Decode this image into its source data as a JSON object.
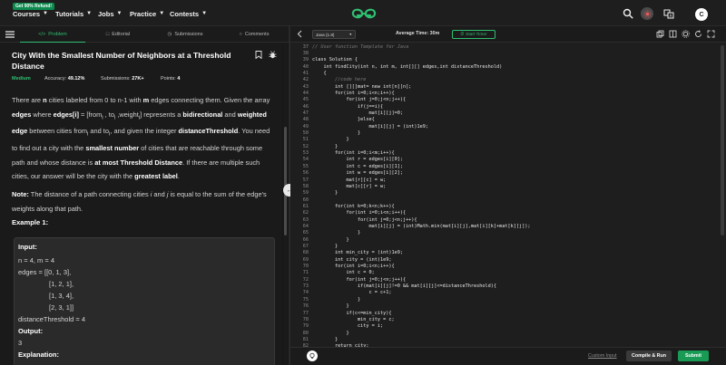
{
  "nav": {
    "promo": "Get 90% Refund!",
    "items": [
      "Courses",
      "Tutorials",
      "Jobs",
      "Practice",
      "Contests"
    ],
    "avatar_letter": "C"
  },
  "left_tabs": [
    {
      "label": "Problem",
      "icon": "code-icon"
    },
    {
      "label": "Editorial",
      "icon": "document-icon"
    },
    {
      "label": "Submissions",
      "icon": "clock-icon"
    },
    {
      "label": "Comments",
      "icon": "comment-icon"
    }
  ],
  "problem": {
    "title": "City With the Smallest Number of Neighbors at a Threshold Distance",
    "difficulty": "Medium",
    "accuracy_label": "Accuracy:",
    "accuracy": "49.12%",
    "submissions_label": "Submissions:",
    "submissions": "27K+",
    "points_label": "Points:",
    "points": "4",
    "desc": {
      "t1": "There are ",
      "n": "n",
      "t2": " cities labeled from 0 to n-1 with ",
      "m": "m",
      "t3": " edges connecting them. Given the array ",
      "edges": "edges",
      "t4": " where ",
      "edges_i": "edges[i]",
      "t5": " = [from",
      "sub_i1": "i",
      "t6": " , to",
      "sub_i2": "i",
      "t7": " ,weight",
      "sub_i3": "i",
      "t8": "]  represents a ",
      "bidirectional": "bidirectional",
      "t9": " and ",
      "weighted": "weighted edge",
      "t10": " between cities from",
      "sub_i4": "i",
      "t11": " and to",
      "sub_i5": "i",
      "t12": ", and given the integer ",
      "threshold": "distanceThreshold",
      "t13": ". You need to find out a city with the ",
      "smallest": "smallest number",
      "t14": " of cities that are reachable through some path and whose distance is ",
      "atmost": "at most Threshold Distance",
      "t15": ". If there are multiple such cities, our answer will be the city with the ",
      "greatest": "greatest label",
      "t16": "."
    },
    "note": {
      "label": "Note:",
      "t1": " The distance of a path connecting cities ",
      "i": "i",
      "t2": " and ",
      "j": "j",
      "t3": " is equal to the sum of the edge's weights along that path."
    },
    "example_title": "Example 1:",
    "example": {
      "input_label": "Input:",
      "l1": "n = 4, m = 4",
      "l2": "edges = [[0, 1, 3],",
      "l3": "[1, 2, 1],",
      "l4": "[1, 3, 4],",
      "l5": "[2, 3, 1]]",
      "l6": "distanceThreshold = 4",
      "output_label": "Output:",
      "output": "3",
      "explanation_label": "Explanation:"
    }
  },
  "editor": {
    "language": "Java (1.8)",
    "avg_time": "Average Time: 30m",
    "start_timer": "Start Timer",
    "lines": [
      {
        "n": "37",
        "code": "// User function Template for Java",
        "cmt": true
      },
      {
        "n": "38",
        "code": ""
      },
      {
        "n": "39",
        "code": "class Solution {"
      },
      {
        "n": "40",
        "code": "    int findCity(int n, int m, int[][] edges,int distanceThreshold)"
      },
      {
        "n": "41",
        "code": "    {"
      },
      {
        "n": "42",
        "code": "        //code here",
        "cmt": true
      },
      {
        "n": "43",
        "code": "        int [][]mat= new int[n][n];"
      },
      {
        "n": "44",
        "code": "        for(int i=0;i<n;i++){"
      },
      {
        "n": "45",
        "code": "            for(int j=0;j<n;j++){"
      },
      {
        "n": "46",
        "code": "                if(j==i){"
      },
      {
        "n": "47",
        "code": "                    mat[i][j]=0;"
      },
      {
        "n": "48",
        "code": "                }else{"
      },
      {
        "n": "49",
        "code": "                    mat[i][j] = (int)1e9;"
      },
      {
        "n": "50",
        "code": "                }"
      },
      {
        "n": "51",
        "code": "            }"
      },
      {
        "n": "52",
        "code": "        }"
      },
      {
        "n": "53",
        "code": "        for(int i=0;i<m;i++){"
      },
      {
        "n": "54",
        "code": "            int r = edges[i][0];"
      },
      {
        "n": "55",
        "code": "            int c = edges[i][1];"
      },
      {
        "n": "56",
        "code": "            int w = edges[i][2];"
      },
      {
        "n": "57",
        "code": "            mat[r][c] = w;"
      },
      {
        "n": "58",
        "code": "            mat[c][r] = w;"
      },
      {
        "n": "59",
        "code": "        }"
      },
      {
        "n": "60",
        "code": ""
      },
      {
        "n": "61",
        "code": "        for(int k=0;k<n;k++){"
      },
      {
        "n": "62",
        "code": "            for(int i=0;i<n;i++){"
      },
      {
        "n": "63",
        "code": "                for(int j=0;j<n;j++){"
      },
      {
        "n": "64",
        "code": "                    mat[i][j] = (int)Math.min(mat[i][j],mat[i][k]+mat[k][j]);"
      },
      {
        "n": "65",
        "code": "                }"
      },
      {
        "n": "66",
        "code": "            }"
      },
      {
        "n": "67",
        "code": "        }"
      },
      {
        "n": "68",
        "code": "        int min_city = (int)1e9;"
      },
      {
        "n": "69",
        "code": "        int city = (int)1e9;"
      },
      {
        "n": "70",
        "code": "        for(int i=0;i<n;i++){"
      },
      {
        "n": "71",
        "code": "            int c = 0;"
      },
      {
        "n": "72",
        "code": "            for(int j=0;j<n;j++){"
      },
      {
        "n": "73",
        "code": "                if(mat[i][j]!=0 && mat[i][j]<=distanceThreshold){"
      },
      {
        "n": "74",
        "code": "                    c = c+1;"
      },
      {
        "n": "75",
        "code": "                }"
      },
      {
        "n": "76",
        "code": "            }"
      },
      {
        "n": "77",
        "code": "            if(c<=min_city){"
      },
      {
        "n": "78",
        "code": "                min_city = c;"
      },
      {
        "n": "79",
        "code": "                city = i;"
      },
      {
        "n": "80",
        "code": "            }"
      },
      {
        "n": "81",
        "code": "        }"
      },
      {
        "n": "82",
        "code": "        return city;"
      }
    ]
  },
  "bottom": {
    "custom_input": "Custom Input",
    "compile_run": "Compile & Run",
    "submit": "Submit"
  },
  "colors": {
    "accent": "#2fbf71",
    "submit": "#1a9b55",
    "bg": "#1a1a1a"
  }
}
